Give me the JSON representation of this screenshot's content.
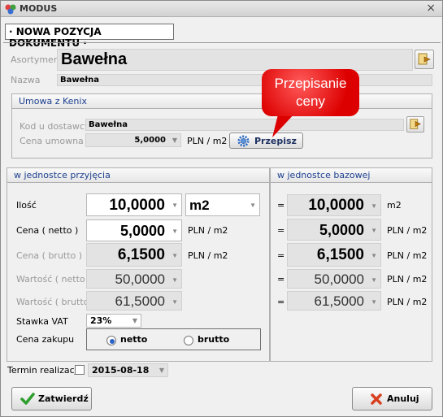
{
  "window": {
    "title": "MODUS",
    "close_label": "×"
  },
  "header": {
    "label": "· NOWA POZYCJA DOKUMENTU ·"
  },
  "asortyment": {
    "label": "Asortyment",
    "value": "Bawełna"
  },
  "nazwa": {
    "label": "Nazwa",
    "value": "Bawełna"
  },
  "umowa": {
    "title": "Umowa z Kenix",
    "kod_label": "Kod u dostawcy",
    "kod_value": "Bawełna",
    "cena_label": "Cena umowna",
    "cena_value": "5,0000",
    "cena_unit": "PLN / m2",
    "przepisz_label": "Przepisz"
  },
  "callout": {
    "line1": "Przepisanie",
    "line2": "ceny"
  },
  "left_panel": {
    "title": "w jednostce przyjęcia",
    "ilosc_label": "Ilość",
    "ilosc_value": "10,0000",
    "unit_value": "m2",
    "cena_netto_label": "Cena ( netto )",
    "cena_netto_value": "5,0000",
    "cena_netto_unit": "PLN / m2",
    "cena_brutto_label": "Cena ( brutto )",
    "cena_brutto_value": "6,1500",
    "cena_brutto_unit": "PLN / m2",
    "wartosc_netto_label": "Wartość ( netto )",
    "wartosc_netto_value": "50,0000",
    "wartosc_brutto_label": "Wartość ( brutto )",
    "wartosc_brutto_value": "61,5000",
    "vat_label": "Stawka VAT",
    "vat_value": "23%",
    "cena_zakupu_label": "Cena zakupu",
    "netto_label": "netto",
    "brutto_label": "brutto"
  },
  "right_panel": {
    "title": "w jednostce bazowej",
    "eq": "=",
    "ilosc_value": "10,0000",
    "ilosc_unit": "m2",
    "cena_netto_value": "5,0000",
    "cena_netto_unit": "PLN / m2",
    "cena_brutto_value": "6,1500",
    "cena_brutto_unit": "PLN / m2",
    "wartosc_netto_value": "50,0000",
    "wartosc_netto_unit": "PLN / m2",
    "wartosc_brutto_value": "61,5000",
    "wartosc_brutto_unit": "PLN / m2"
  },
  "termin": {
    "label": "Termin realizacji",
    "value": "2015-08-18",
    "checked": false
  },
  "buttons": {
    "ok_label": "Zatwierdź",
    "cancel_label": "Anuluj"
  },
  "colors": {
    "callout_red": "#dd0000",
    "group_title_blue": "#1c3f8f",
    "ok_green": "#2e9e2e",
    "cancel_red": "#d84020"
  },
  "icons": [
    "modus-logo-icon",
    "close-icon",
    "pick-arrow-icon",
    "gear-icon",
    "chevron-down-icon",
    "checkmark-icon",
    "cross-icon"
  ]
}
